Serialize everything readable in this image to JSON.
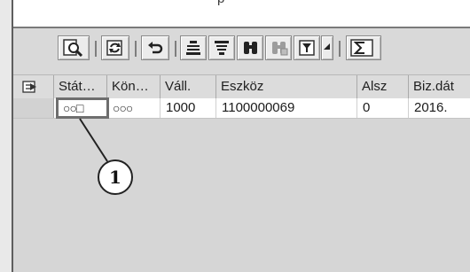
{
  "window": {
    "top_partial_text": "p"
  },
  "toolbar": {
    "buttons": [
      {
        "icon": "details-magnifier-icon"
      },
      {
        "icon": "refresh-icon"
      },
      {
        "icon": "undo-icon"
      },
      {
        "icon": "align-left-icon"
      },
      {
        "icon": "align-center-icon"
      },
      {
        "icon": "find-binoculars-icon"
      },
      {
        "icon": "find-next-binoculars-icon"
      },
      {
        "icon": "filter-icon"
      },
      {
        "icon": "dropdown-arrow-icon"
      },
      {
        "icon": "sum-icon"
      }
    ]
  },
  "table": {
    "columns": [
      "Stát…",
      "Kön…",
      "Váll.",
      "Eszköz",
      "Alsz",
      "Biz.dát"
    ],
    "rows": [
      {
        "status": "○○□",
        "kon": "○○○",
        "vall": "1000",
        "eszkoz": "1100000069",
        "alsz": "0",
        "bizdat": "2016."
      }
    ]
  },
  "callout": {
    "number": "1"
  }
}
